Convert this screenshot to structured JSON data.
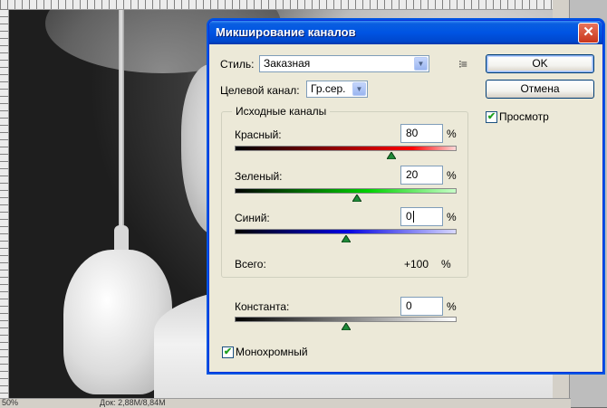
{
  "dialog": {
    "title": "Микширование каналов",
    "close_glyph": "✕"
  },
  "preset": {
    "label": "Стиль:",
    "value": "Заказная"
  },
  "target_channel": {
    "label": "Целевой канал:",
    "value": "Гр.сер."
  },
  "buttons": {
    "ok": "OK",
    "cancel": "Отмена"
  },
  "preview": {
    "label": "Просмотр",
    "checked": true
  },
  "source_channels": {
    "title": "Исходные каналы",
    "channels": [
      {
        "label": "Красный:",
        "value": "80",
        "unit": "%",
        "slider_fraction": 0.7,
        "color": "#e00000"
      },
      {
        "label": "Зеленый:",
        "value": "20",
        "unit": "%",
        "slider_fraction": 0.55,
        "color": "#00d000"
      },
      {
        "label": "Синий:",
        "value": "0",
        "unit": "%",
        "slider_fraction": 0.5,
        "color": "#0000e0"
      }
    ],
    "total_label": "Всего:",
    "total_value": "+100",
    "total_unit": "%"
  },
  "constant": {
    "label": "Константа:",
    "value": "0",
    "unit": "%",
    "slider_fraction": 0.5
  },
  "monochrome": {
    "label": "Монохромный",
    "checked": true
  },
  "status": {
    "zoom": "50%",
    "doc": "Док: 2,88M/8,84M"
  },
  "icons": {
    "menu": "list-menu-icon",
    "dropdown": "chevron-down-icon",
    "check": "check-icon",
    "slider_thumb": "triangle-up-icon"
  }
}
